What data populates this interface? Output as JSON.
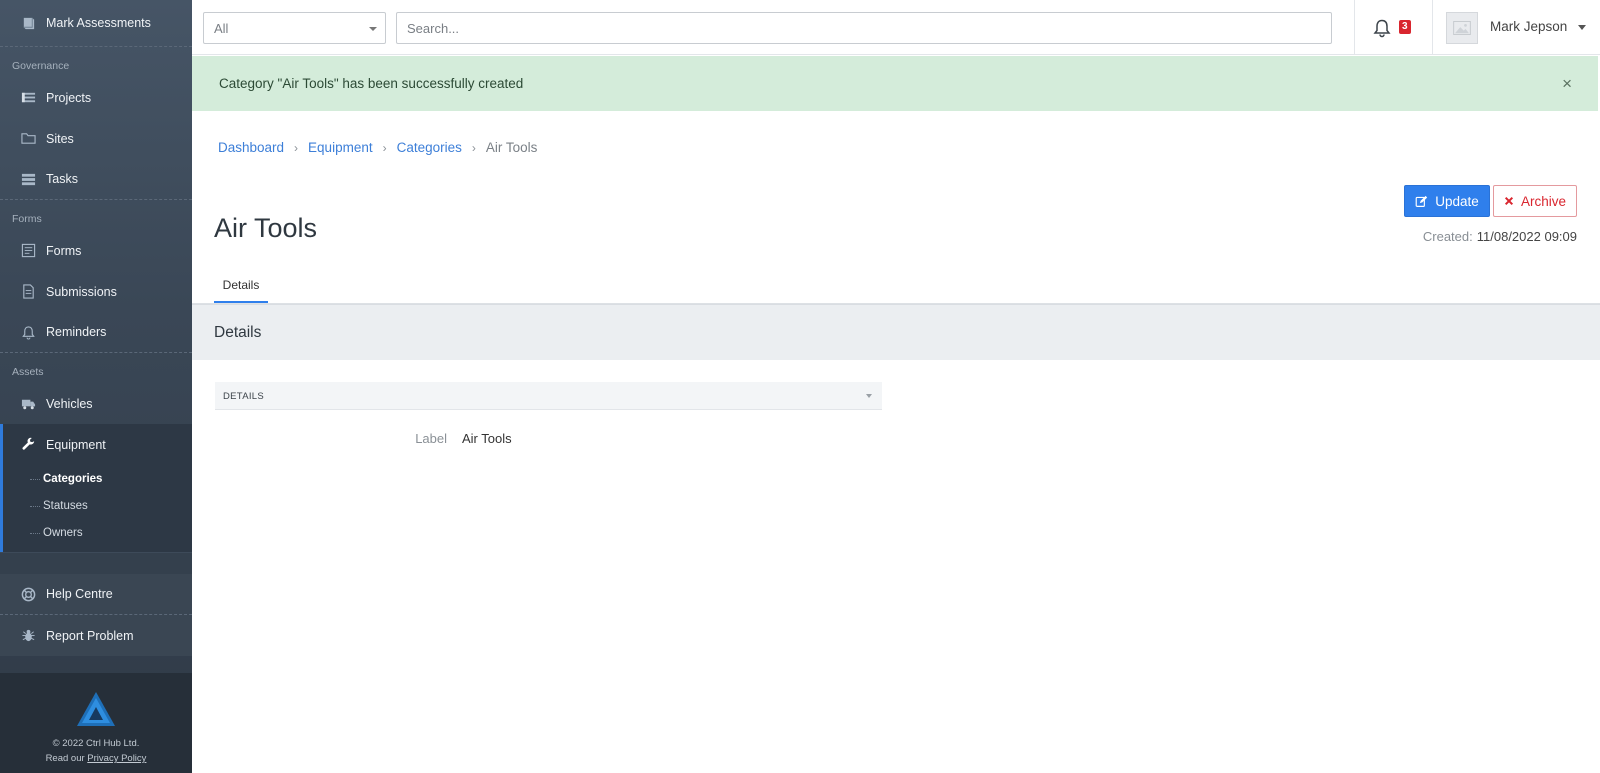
{
  "sidebar": {
    "top_item": {
      "label": "Mark Assessments",
      "icon": "book-icon"
    },
    "sections": [
      {
        "title": "Governance",
        "items": [
          {
            "label": "Projects",
            "icon": "projects-icon"
          },
          {
            "label": "Sites",
            "icon": "folder-icon"
          },
          {
            "label": "Tasks",
            "icon": "tasks-icon"
          }
        ]
      },
      {
        "title": "Forms",
        "items": [
          {
            "label": "Forms",
            "icon": "form-icon"
          },
          {
            "label": "Submissions",
            "icon": "document-icon"
          },
          {
            "label": "Reminders",
            "icon": "bell-icon"
          }
        ]
      },
      {
        "title": "Assets",
        "items": [
          {
            "label": "Vehicles",
            "icon": "truck-icon"
          },
          {
            "label": "Equipment",
            "icon": "wrench-icon"
          }
        ]
      }
    ],
    "equipment_subitems": [
      "Categories",
      "Statuses",
      "Owners"
    ],
    "help": {
      "label": "Help Centre",
      "icon": "lifebuoy-icon"
    },
    "report": {
      "label": "Report Problem",
      "icon": "bug-icon"
    },
    "footer": {
      "copyright": "© 2022 Ctrl Hub Ltd.",
      "privacy_prefix": "Read our",
      "privacy_link": "Privacy Policy"
    }
  },
  "topbar": {
    "filter_value": "All",
    "search_placeholder": "Search...",
    "notification_count": "3",
    "user_name": "Mark Jepson"
  },
  "alert": {
    "message": "Category \"Air Tools\" has been successfully created",
    "close": "×"
  },
  "breadcrumb": {
    "items": [
      "Dashboard",
      "Equipment",
      "Categories"
    ],
    "current": "Air Tools"
  },
  "page": {
    "title": "Air Tools",
    "update_label": "Update",
    "archive_label": "Archive",
    "created_label": "Created:",
    "created_value": "11/08/2022 09:09",
    "tab": "Details",
    "section_title": "Details",
    "panel_title": "DETAILS",
    "field_label": "Label",
    "field_value": "Air Tools"
  },
  "colors": {
    "primary": "#2f7fec",
    "danger": "#d9262f",
    "success_bg": "#d4ecda",
    "sidebar_bg": "#3a4756"
  }
}
